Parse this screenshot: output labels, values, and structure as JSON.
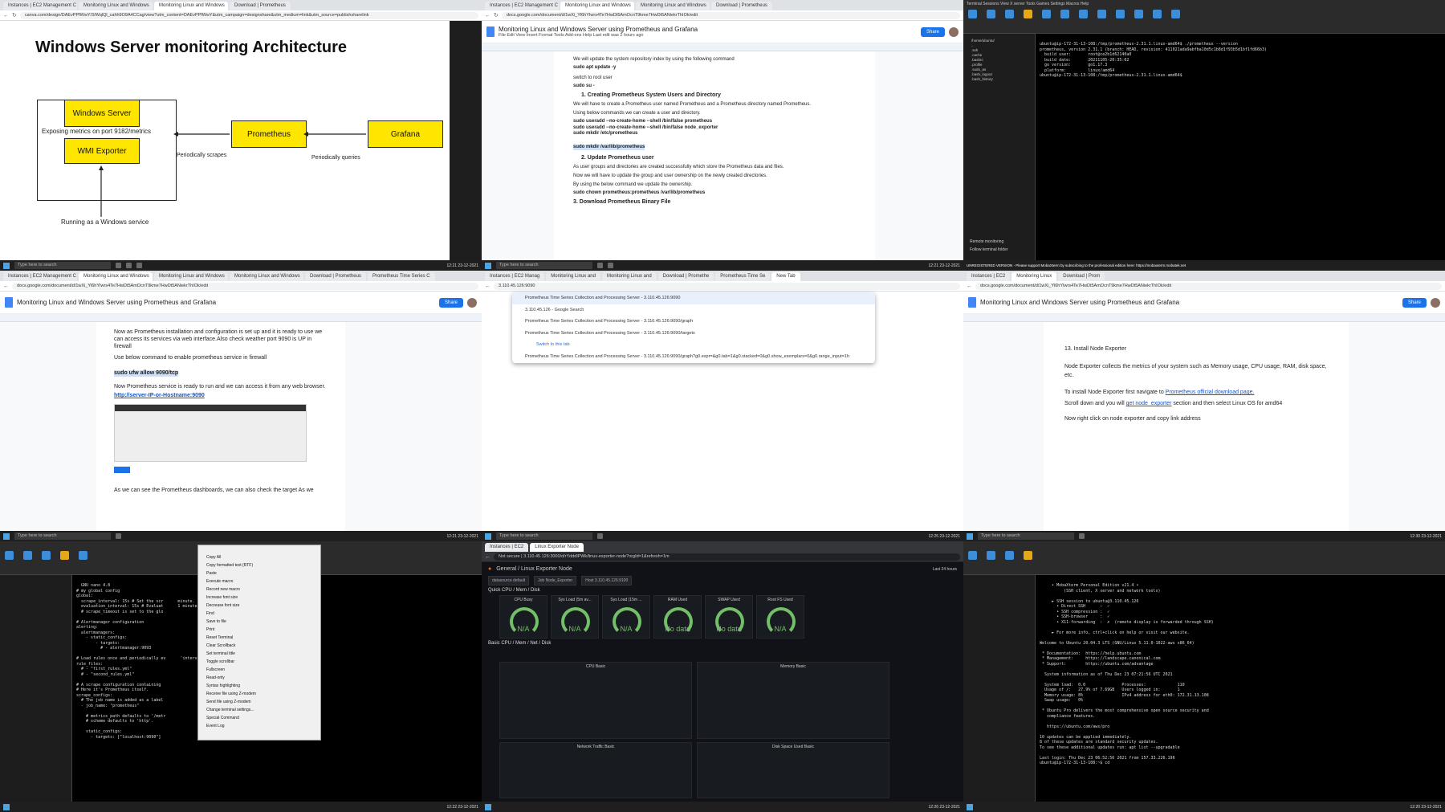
{
  "tile1": {
    "tabs": [
      "Instances | EC2 Management C",
      "Monitoring Linux and Windows",
      "Monitoring Linux and Windows",
      "Download | Prometheus"
    ],
    "url": "canva.com/design/DAEvPPfWwY/3/WqlQl_cahh9O9A4CCag/view?utm_content=DAEvPPfWwY&utm_campaign=designshare&utm_medium=link&utm_source=publishsharelink",
    "title": "Windows Server monitoring Architecture",
    "windows_server": "Windows Server",
    "wmi_exporter": "WMI Exporter",
    "prometheus": "Prometheus",
    "grafana": "Grafana",
    "exposing": "Exposing metrics on port 9182/metrics",
    "scrapes": "Periodically scrapes",
    "queries": "Periodically queries",
    "running": "Running as a Windows service",
    "search": "Type here to search",
    "time": "12:21 23-12-2021"
  },
  "tile2": {
    "tabs": [
      "Instances | EC2 Management C",
      "Monitoring Linux and Windows",
      "Monitoring Linux and Windows",
      "Download | Prometheus"
    ],
    "url": "docs.google.com/document/d/1wXi_Yl6hYIwrs4Te7HwDt5AmOcnT9kme7HwDt5ANiekrThIOk/edit",
    "doc_title": "Monitoring Linux and Windows Server using Prometheus and Grafana",
    "menu": "File  Edit  View  Insert  Format  Tools  Add-ons  Help   Last edit was 2 hours ago",
    "share": "Share",
    "p1": "We will update the system repository index by using the following command",
    "c1": "sudo apt update -y",
    "p2": "switch to root user",
    "c2": "sudo su -",
    "h1": "1.   Creating Prometheus System Users and Directory",
    "p3": "We will have to create a Prometheus user named Prometheus and a Prometheus directory named Prometheus.",
    "p4": "Using below commands we can create a user and directory.",
    "c3": "sudo useradd --no-create-home --shell /bin/false prometheus",
    "c4": "sudo useradd --no-create-home --shell /bin/false node_exporter",
    "c5": "sudo mkdir /etc/prometheus",
    "c6": "sudo mkdir /var/lib/prometheus",
    "h2": "2.   Update Prometheus user",
    "p5": "As user groups and directories are created successfully which store the Prometheus data and files.",
    "p6": "Now we will have to update the group and user ownership on the newly created directories.",
    "p7": "By using the below command we update the ownership.",
    "c7": "sudo chown prometheus:prometheus /var/lib/prometheus",
    "h3": "3. Download Prometheus Binary File",
    "search": "Type here to search",
    "time": "12:21 23-12-2021"
  },
  "tile3": {
    "menu": "Terminal  Sessions  View  X server  Tools  Games  Settings  Macros  Help",
    "icons": [
      "Session",
      "Servers",
      "Tools",
      "Games",
      "Sessions",
      "View",
      "Split",
      "MultiExec",
      "Tunneling",
      "Packages",
      "Settings",
      "Help"
    ],
    "terminal": "ubuntu@ip-172-31-13-108:/tmp/prometheus-2.31.1.linux-amd64$ ./prometheus --version\nprometheus, version 2.31.1 (branch: HEAD, revision: 411021ada9abfba10d5c1b8d1f93b5d1bf1fd66b3)\n  build user:       root@ce2b1d62140a0\n  build date:       20211105-20:35:02\n  go version:       go1.17.3\n  platform:         linux/amd64\nubuntu@ip-172-31-13-108:/tmp/prometheus-2.31.1.linux-amd64$ ",
    "tree": [
      "/home/ubuntu/",
      "..",
      ".ssh",
      ".cache",
      ".bashrc",
      ".profile",
      ".sudo_as",
      ".bash_logout",
      ".bash_history"
    ],
    "remote": "Remote monitoring",
    "follow": "Follow terminal folder",
    "banner": "UNREGISTERED VERSION - Please support MobaXterm by subscribing to the professional edition here: https://mobaxterm.mobatek.net",
    "time": "12:20 23-12-2021"
  },
  "tile4": {
    "tabs": [
      "Instances | EC2 Management C",
      "Monitoring Linux and Windows",
      "Monitoring Linux and Windows",
      "Monitoring Linux and Windows",
      "Download | Prometheus",
      "Prometheus Time Series C"
    ],
    "url": "docs.google.com/document/d/1wXi_Yl6hYIwrs4Te7HwDt5AmOcnT9kme7HwDt5ANiekrThIOk/edit",
    "doc_title": "Monitoring Linux and Windows Server using Prometheus and Grafana",
    "p1": "Now as Prometheus installation and configuration is set up and it is ready to use we can access  its services via web interface.Also check weather port 9090 is UP in firewall",
    "p2": "Use below command to enable prometheus service in firewall",
    "c1": "sudo ufw allow 9090/tcp",
    "p3": "Now Prometheus service is ready to run and we can access it from any web browser.",
    "c2": "http://server-IP-or-Hostname:9090",
    "p4": "As we can see the Prometheus dashboards, we can also check the target As we",
    "search": "Type here to search",
    "time": "12:21 23-12-2021"
  },
  "tile5": {
    "tabs": [
      "Instances | EC2 Manag",
      "Monitoring Linux and",
      "Monitoring Linux and",
      "Download | Promethe",
      "Prometheus Time Se",
      "New Tab"
    ],
    "url": "3.110.45.126:9090",
    "rows": [
      "Prometheus Time Series Collection and Processing Server - 3.110.45.126:9090",
      "3.110.45.126 - Google Search",
      "Prometheus Time Series Collection and Processing Server - 3.110.45.126:9090/graph",
      "Prometheus Time Series Collection and Processing Server - 3.110.45.126:9090/targets",
      "Switch to this tab",
      "Prometheus Time Series Collection and Processing Server - 3.110.45.126:9090/graph?g0.expr=&g0.tab=1&g0.stacked=0&g0.show_exemplars=0&g0.range_input=1h"
    ],
    "search": "Type here to search",
    "time": "12:25 23-12-2021"
  },
  "tile6": {
    "url": "docs.google.com/document/d/1wXi_Yl6hYIwrs4Te7HwDt5AmOcnT9kme7HwDt5ANiekrThIOk/edit",
    "doc_title": "Monitoring Linux and Windows Server using Prometheus and Grafana",
    "h1": "13. Install Node Exporter",
    "p1": "Node Exporter collects the metrics of your system such as Memory usage, CPU usage, RAM, disk space, etc.",
    "p2a": "To install Node Exporter first navigate to ",
    "p2b": "Prometheus official download page.",
    "p3a": "Scroll down and you will ",
    "p3b": "get node_exporter",
    "p3c": " section and then select Linux OS for amd64",
    "p4": "Now right click on node exporter and copy link address",
    "search": "Type here to search",
    "time": "12:30 23-12-2021"
  },
  "tile7": {
    "menu_items": [
      "Copy All",
      "Copy formatted text (RTF)",
      "Paste",
      "Execute macro",
      "Record new macro",
      "Increase font size",
      "Decrease font size",
      "Find",
      "Save to file",
      "Print",
      "Reset Terminal",
      "Clear Scrollback",
      "Set terminal title",
      "Toggle scrollbar",
      "Fullscreen",
      "Read-only",
      "Syntax highlighting",
      "Receive file using Z-modem",
      "Send file using Z-modem",
      "Change terminal settings...",
      "Special Command",
      "Event Log"
    ],
    "terminal": "  GNU nano 4.8\n# my global config\nglobal:\n  scrape_interval: 15s # Set the scr      minute.\n  evaluation_interval: 15s # Evaluat      1 minute.\n  # scrape_timeout is set to the glo\n\n# Alertmanager configuration\nalerting:\n  alertmanagers:\n    - static_configs:\n        - targets:\n          # - alertmanager:9093\n\n# Load rules once and periodically ev      'interval'.\nrule_files:\n  # - \"first_rules.yml\"\n  # - \"second_rules.yml\"\n\n# A scrape configuration containing\n# Here it's Prometheus itself.\nscrape_configs:\n  # The job name is added as a label\n  - job_name: \"prometheus\"\n\n    # metrics_path defaults to '/metr\n    # scheme defaults to 'http'.\n\n    static_configs:\n      - targets: [\"localhost:9090\"]",
    "time": "12:22 23-12-2021"
  },
  "tile8": {
    "url": "Not secure | 3.110.45.126:3000/d/rYdddlPWk/linux-exporter-node?orgId=1&refresh=1m",
    "breadcrumb": "General / Linux Exporter Node",
    "datasource": "datasource  default",
    "job": "Job  Node_Exporter",
    "host": "Host  3.110.45.126:9100",
    "range": "Last 24 hours",
    "row1": "Quick CPU / Mem / Disk",
    "gauges": [
      {
        "t": "CPU Busy",
        "v": "N/A"
      },
      {
        "t": "Sys Load (5m av...",
        "v": "N/A"
      },
      {
        "t": "Sys Load (15m ...",
        "v": "N/A"
      },
      {
        "t": "RAM Used",
        "v": "No data"
      },
      {
        "t": "SWAP Used",
        "v": "No data"
      },
      {
        "t": "Root FS Used",
        "v": "N/A"
      }
    ],
    "row2": "Basic CPU / Mem / Net / Disk",
    "cpu_basic": "CPU Basic",
    "mem_basic": "Memory Basic",
    "net": "Network Traffic Basic",
    "disk": "Disk Space Used Basic",
    "time": "12:26 23-12-2021"
  },
  "tile9": {
    "terminal": "     • MobaXterm Personal Edition v21.4 •\n          (SSH client, X server and network tools)\n\n     ► SSH session to ubuntu@3.110.45.126\n       • Direct SSH      :  ✓\n       • SSH compression :  ✓\n       • SSH-browser     :  ✓\n       • X11-forwarding  :  ✗  (remote display is forwarded through SSH)\n\n     ► For more info, ctrl+click on help or visit our website.\n\nWelcome to Ubuntu 20.04.3 LTS (GNU/Linux 5.11.0-1022-aws x86_64)\n\n * Documentation:  https://help.ubuntu.com\n * Management:     https://landscape.canonical.com\n * Support:        https://ubuntu.com/advantage\n\n  System information as of Thu Dec 23 07:21:56 UTC 2021\n\n  System load:  0.0               Processes:             110\n  Usage of /:   27.9% of 7.69GB   Users logged in:       1\n  Memory usage: 8%                IPv4 address for eth0: 172.31.13.108\n  Swap usage:   0%\n\n * Ubuntu Pro delivers the most comprehensive open source security and\n   compliance features.\n\n   https://ubuntu.com/aws/pro\n\n10 updates can be applied immediately.\n8 of these updates are standard security updates.\nTo see these additional updates run: apt list --upgradable\n\nLast login: Thu Dec 23 06:52:56 2021 from 157.33.226.196\nubuntu@ip-172-31-13-108:~$ cd",
    "time": "12:20 23-12-2021"
  }
}
